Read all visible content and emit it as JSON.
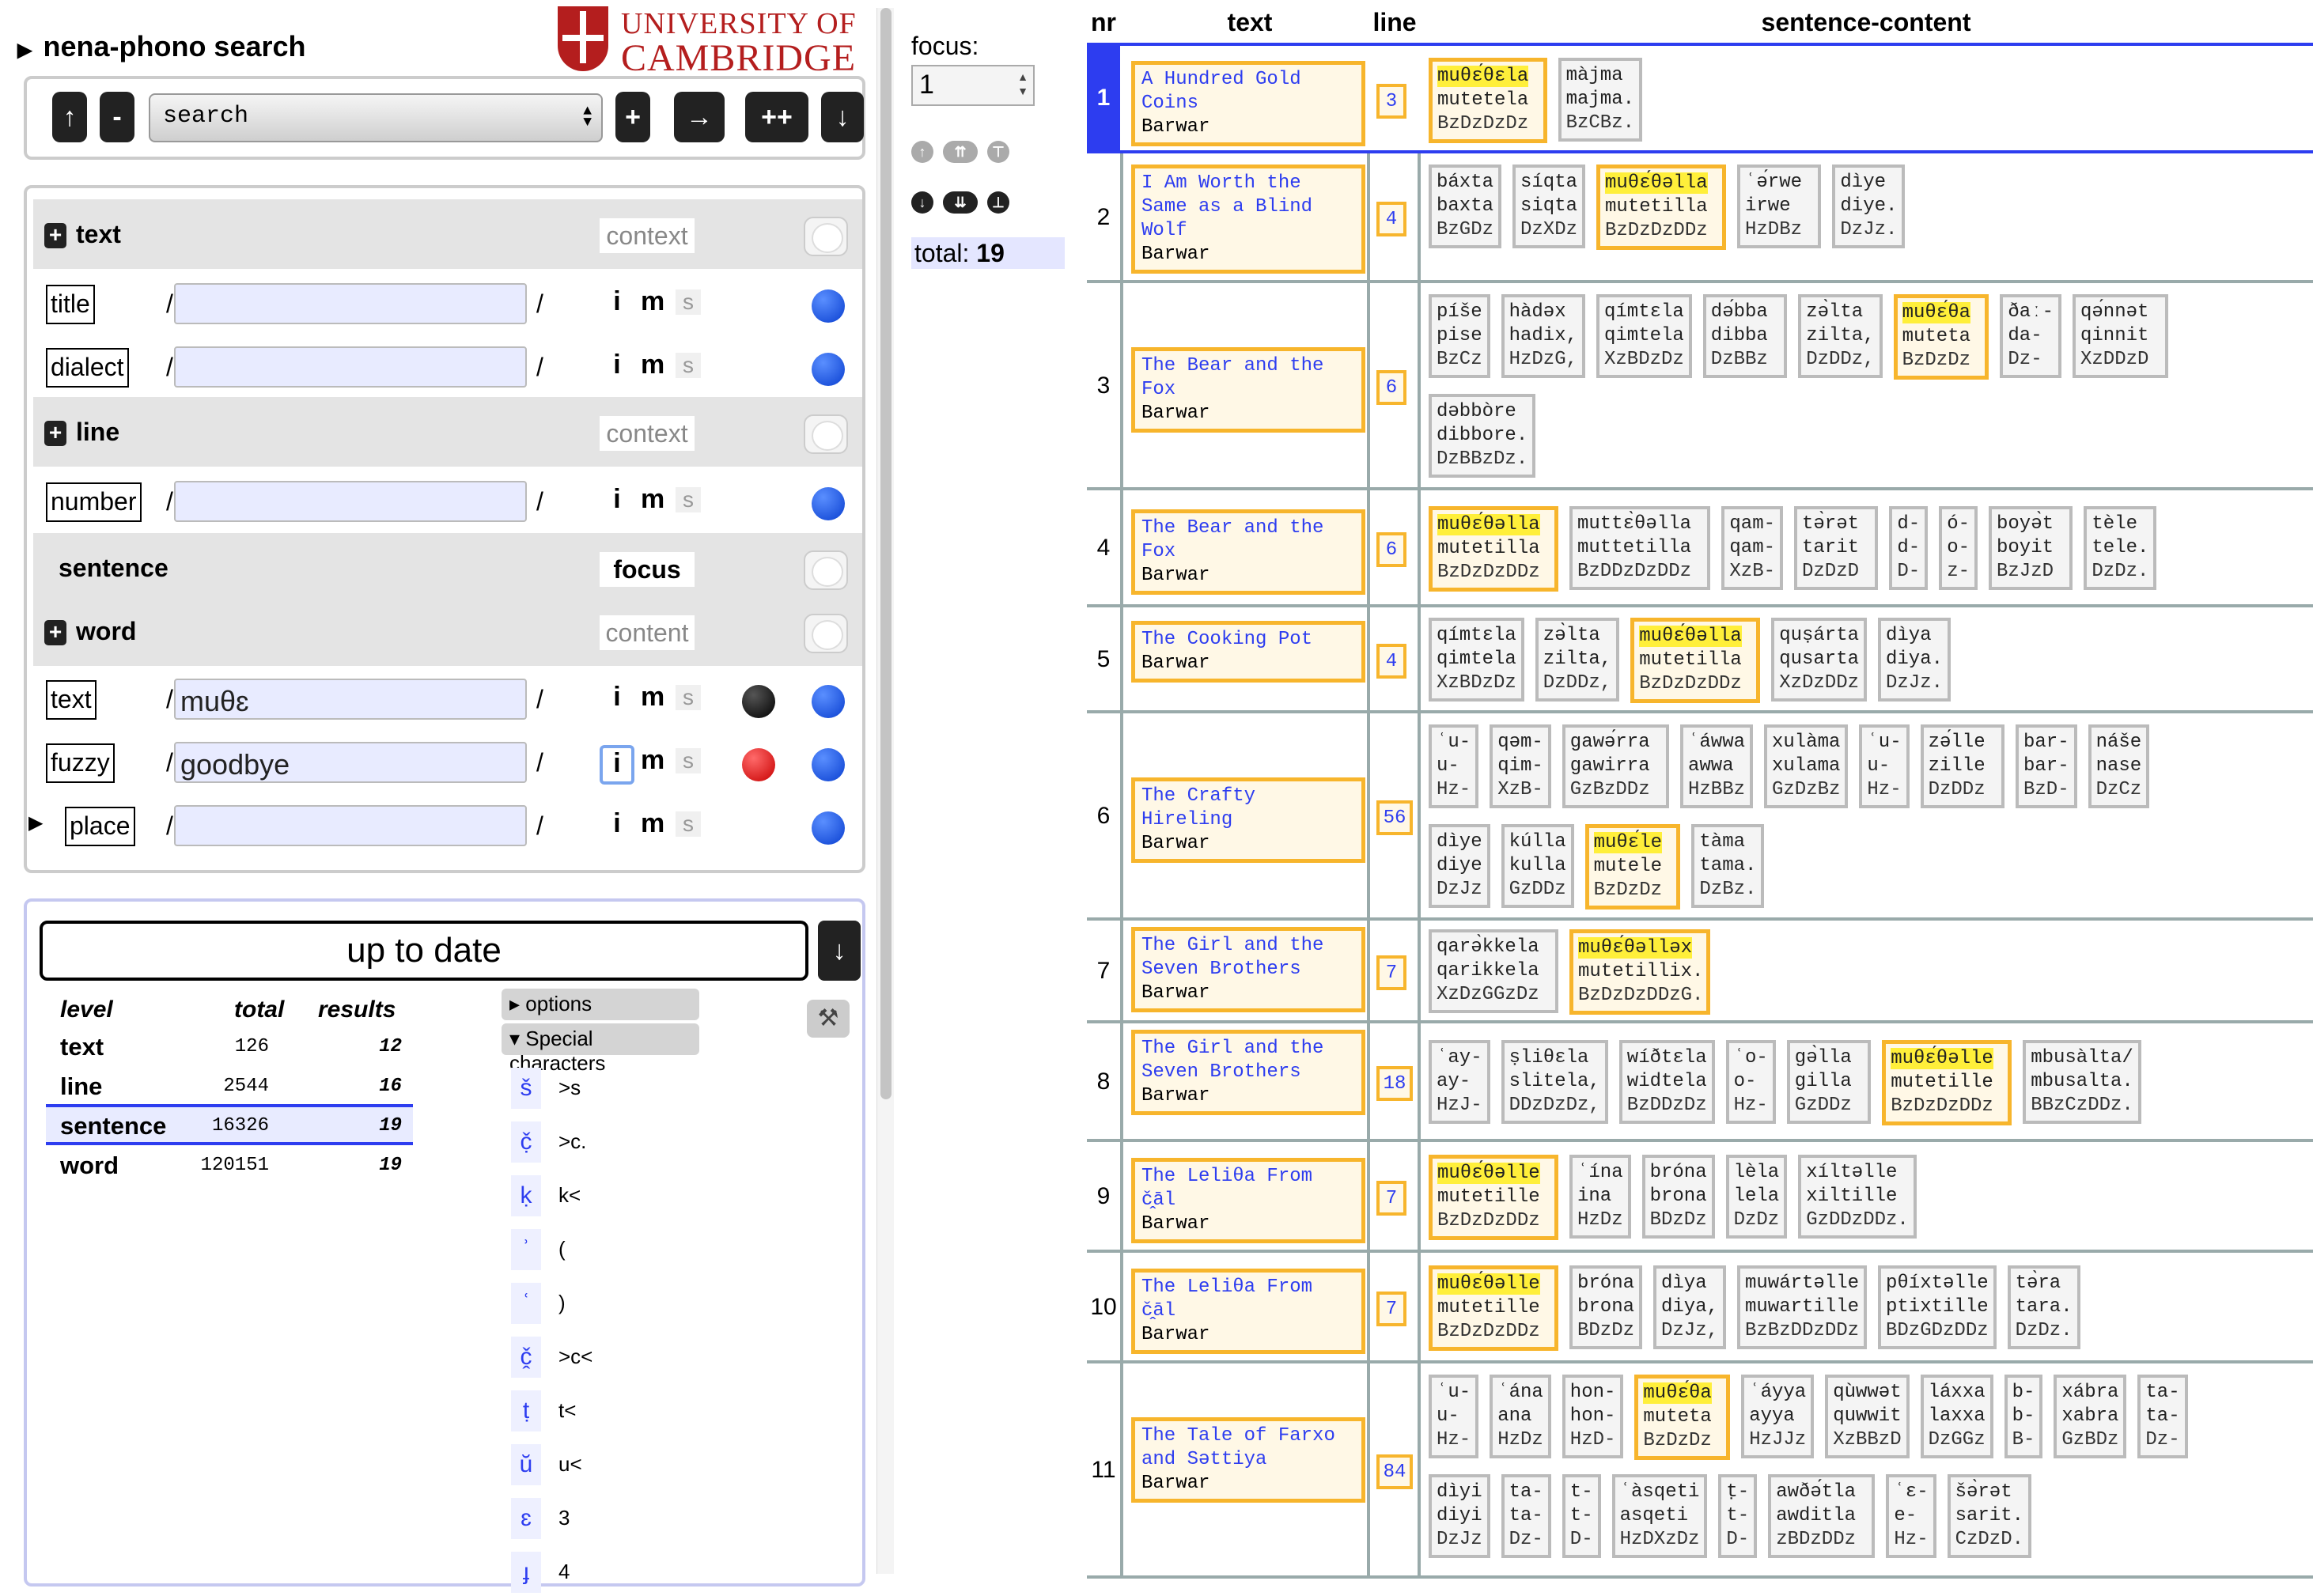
{
  "app": {
    "title": "nena-phono search"
  },
  "logo": {
    "line1": "UNIVERSITY OF",
    "line2": "CAMBRIDGE"
  },
  "toolbar": {
    "up": "↑",
    "minus": "-",
    "search_value": "search",
    "plus": "+",
    "next": "→",
    "plusplus": "++",
    "down": "↓"
  },
  "query": {
    "text_group": {
      "label": "text",
      "mode": "context"
    },
    "title_field": {
      "label": "title",
      "value": ""
    },
    "dialect_field": {
      "label": "dialect",
      "value": ""
    },
    "line_group": {
      "label": "line",
      "mode": "context"
    },
    "number_field": {
      "label": "number",
      "value": ""
    },
    "sentence_group": {
      "label": "sentence",
      "mode": "focus"
    },
    "word_group": {
      "label": "word",
      "mode": "content"
    },
    "wtext_field": {
      "label": "text",
      "value": "muθɛ"
    },
    "fuzzy_field": {
      "label": "fuzzy",
      "value": "goodbye"
    },
    "place_field": {
      "label": "place",
      "value": ""
    },
    "slash": "/",
    "i": "i",
    "m": "m",
    "s": "s",
    "plus_sign": "+"
  },
  "status": {
    "text": "up to date",
    "download": "↓"
  },
  "stats": {
    "headers": {
      "level": "level",
      "total": "total",
      "results": "results"
    },
    "rows": [
      {
        "level": "text",
        "total": "126",
        "results": "12"
      },
      {
        "level": "line",
        "total": "2544",
        "results": "16"
      },
      {
        "level": "sentence",
        "total": "16326",
        "results": "19"
      },
      {
        "level": "word",
        "total": "120151",
        "results": "19"
      }
    ]
  },
  "options": {
    "label": "options",
    "special": "Special characters",
    "tools_icon": "hammer-wrench-icon"
  },
  "special_chars": [
    {
      "glyph": "š",
      "key": ">s"
    },
    {
      "glyph": "č̣",
      "key": ">c."
    },
    {
      "glyph": "ḳ",
      "key": "k<"
    },
    {
      "glyph": "ʾ",
      "key": "("
    },
    {
      "glyph": "ʿ",
      "key": ")"
    },
    {
      "glyph": "č̭",
      "key": ">c<"
    },
    {
      "glyph": "ṭ",
      "key": "t<"
    },
    {
      "glyph": "ŭ",
      "key": "u<"
    },
    {
      "glyph": "ɛ",
      "key": "3"
    },
    {
      "glyph": "ɟ",
      "key": "4"
    }
  ],
  "focus": {
    "label": "focus:",
    "value": "1"
  },
  "total": {
    "label": "total:",
    "value": "19"
  },
  "results": {
    "headers": {
      "nr": "nr",
      "text": "text",
      "line": "line",
      "content": "sentence-content"
    },
    "rows": [
      {
        "nr": "1",
        "title": "A Hundred Gold Coins",
        "dialect": "Barwar",
        "line": "3",
        "words": [
          [
            "muθɛ́θɛla",
            "mutetela",
            "BzDzDzDz",
            1
          ],
          [
            "màjma",
            "majma.",
            "BzCBz.",
            0
          ]
        ]
      },
      {
        "nr": "2",
        "title": "I Am Worth the Same as a Blind Wolf",
        "dialect": "Barwar",
        "line": "4",
        "words": [
          [
            "báxta",
            "baxta",
            "BzGDz",
            0
          ],
          [
            "síqta",
            "siqta",
            "DzXDz",
            0
          ],
          [
            "muθɛ́θəlla",
            "mutetilla",
            "BzDzDzDDz",
            1
          ],
          [
            "ʿə́rwe",
            "irwe",
            "HzDBz",
            0
          ],
          [
            "dìye",
            "diye.",
            "DzJz.",
            0
          ]
        ]
      },
      {
        "nr": "3",
        "title": "The Bear and the Fox",
        "dialect": "Barwar",
        "line": "6",
        "words": [
          [
            "píše",
            "pise",
            "BzCz",
            0
          ],
          [
            "hàdəx",
            "hadix,",
            "HzDzG,",
            0
          ],
          [
            "qímtɛla",
            "qimtela",
            "XzBDzDz",
            0
          ],
          [
            "də́bba",
            "dibba",
            "DzBBz",
            0
          ],
          [
            "zə̀lta",
            "zilta,",
            "DzDDz,",
            0
          ],
          [
            "muθɛ́θa",
            "muteta",
            "BzDzDz",
            1
          ],
          [
            "ðaː-",
            "da-",
            "Dz-",
            0
          ],
          [
            "qə́nnət",
            "qinnit",
            "XzDDzD",
            0
          ],
          [
            "dəbbòre",
            "dibbore.",
            "DzBBzDz.",
            0
          ]
        ]
      },
      {
        "nr": "4",
        "title": "The Bear and the Fox",
        "dialect": "Barwar",
        "line": "6",
        "words": [
          [
            "muθɛ́θəlla",
            "mutetilla",
            "BzDzDzDDz",
            1
          ],
          [
            "muttɛ̀θəlla",
            "muttetilla",
            "BzDDzDzDDz",
            0
          ],
          [
            "qam-",
            "qam-",
            "XzB-",
            0
          ],
          [
            "tə̀rət",
            "tarit",
            "DzDzD",
            0
          ],
          [
            "d-",
            "d-",
            "D-",
            0
          ],
          [
            "ó-",
            "o-",
            "z-",
            0
          ],
          [
            "boyə̀t",
            "boyit",
            "BzJzD",
            0
          ],
          [
            "tèle",
            "tele.",
            "DzDz.",
            0
          ]
        ]
      },
      {
        "nr": "5",
        "title": "The Cooking Pot",
        "dialect": "Barwar",
        "line": "4",
        "words": [
          [
            "qímtɛla",
            "qimtela",
            "XzBDzDz",
            0
          ],
          [
            "zə̀lta",
            "zilta,",
            "DzDDz,",
            0
          ],
          [
            "muθɛ́θəlla",
            "mutetilla",
            "BzDzDzDDz",
            1
          ],
          [
            "quṣárta",
            "qusarta",
            "XzDzDDz",
            0
          ],
          [
            "dìya",
            "diya.",
            "DzJz.",
            0
          ]
        ]
      },
      {
        "nr": "6",
        "title": "The Crafty Hireling",
        "dialect": "Barwar",
        "line": "56",
        "words": [
          [
            "ʿu-",
            "u-",
            "Hz-",
            0
          ],
          [
            "qəm-",
            "qim-",
            "XzB-",
            0
          ],
          [
            "gawə́rra",
            "gawirra",
            "GzBzDDz",
            0
          ],
          [
            "ʿáwwa",
            "awwa",
            "HzBBz",
            0
          ],
          [
            "xulàma",
            "xulama",
            "GzDzBz",
            0
          ],
          [
            "ʿu-",
            "u-",
            "Hz-",
            0
          ],
          [
            "zə́lle",
            "zille",
            "DzDDz",
            0
          ],
          [
            "bar-",
            "bar-",
            "BzD-",
            0
          ],
          [
            "náše",
            "nase",
            "DzCz",
            0
          ],
          [
            "dìye",
            "diye",
            "DzJz",
            0
          ],
          [
            "kúlla",
            "kulla",
            "GzDDz",
            0
          ],
          [
            "muθɛ́le",
            "mutele",
            "BzDzDz",
            1
          ],
          [
            "tàma",
            "tama.",
            "DzBz.",
            0
          ]
        ]
      },
      {
        "nr": "7",
        "title": "The Girl and the Seven Brothers",
        "dialect": "Barwar",
        "line": "7",
        "words": [
          [
            "qarə̀kkela",
            "qarikkela",
            "XzDzGGzDz",
            0
          ],
          [
            "muθɛ́θəlləx",
            "mutetillix.",
            "BzDzDzDDzG.",
            1
          ]
        ]
      },
      {
        "nr": "8",
        "title": "The Girl and the Seven Brothers",
        "dialect": "Barwar",
        "line": "18",
        "words": [
          [
            "ʿay-",
            "ay-",
            "HzJ-",
            0
          ],
          [
            "ṣliθɛla",
            "slitela,",
            "DDzDzDz,",
            0
          ],
          [
            "wíðtɛla",
            "widtela",
            "BzDDzDz",
            0
          ],
          [
            "ʿo-",
            "o-",
            "Hz-",
            0
          ],
          [
            "gə̀lla",
            "gilla",
            "GzDDz",
            0
          ],
          [
            "muθɛ́θəlle",
            "mutetille",
            "BzDzDzDDz",
            1
          ],
          [
            "mbusàlta/",
            "mbusalta.",
            "BBzCzDDz.",
            0
          ]
        ]
      },
      {
        "nr": "9",
        "title": "The Leliθa From č̭āl",
        "dialect": "Barwar",
        "line": "7",
        "words": [
          [
            "muθɛ́θəlle",
            "mutetille",
            "BzDzDzDDz",
            1
          ],
          [
            "ʿína",
            "ina",
            "HzDz",
            0
          ],
          [
            "bróna",
            "brona",
            "BDzDz",
            0
          ],
          [
            "lèla",
            "lela",
            "DzDz",
            0
          ],
          [
            "xíltəlle",
            "xiltille",
            "GzDDzDDz.",
            0
          ]
        ]
      },
      {
        "nr": "10",
        "title": "The Leliθa From č̭āl",
        "dialect": "Barwar",
        "line": "7",
        "words": [
          [
            "muθɛ́θəlle",
            "mutetille",
            "BzDzDzDDz",
            1
          ],
          [
            "bróna",
            "brona",
            "BDzDz",
            0
          ],
          [
            "dìya",
            "diya,",
            "DzJz,",
            0
          ],
          [
            "muwártəlle",
            "muwartille",
            "BzBzDDzDDz",
            0
          ],
          [
            "pθíxtəlle",
            "ptixtille",
            "BDzGDzDDz",
            0
          ],
          [
            "tə̀ra",
            "tara.",
            "DzDz.",
            0
          ]
        ]
      },
      {
        "nr": "11",
        "title": "The Tale of Farxo and Səttiya",
        "dialect": "Barwar",
        "line": "84",
        "words": [
          [
            "ʿu-",
            "u-",
            "Hz-",
            0
          ],
          [
            "ʿána",
            "ana",
            "HzDz",
            0
          ],
          [
            "hon-",
            "hon-",
            "HzD-",
            0
          ],
          [
            "muθɛ́θa",
            "muteta",
            "BzDzDz",
            1
          ],
          [
            "ʿáyya",
            "ayya",
            "HzJJz",
            0
          ],
          [
            "qùwwət",
            "quwwit",
            "XzBBzD",
            0
          ],
          [
            "láxxa",
            "laxxa",
            "DzGGz",
            0
          ],
          [
            "b-",
            "b-",
            "B-",
            0
          ],
          [
            "xábra",
            "xabra",
            "GzBDz",
            0
          ],
          [
            "ta-",
            "ta-",
            "Dz-",
            0
          ],
          [
            "dìyi",
            "diyi",
            "DzJz",
            0
          ],
          [
            "ta-",
            "ta-",
            "Dz-",
            0
          ],
          [
            "t-",
            "t-",
            "D-",
            0
          ],
          [
            "ʿàsqeti",
            "asqeti",
            "HzDXzDz",
            0
          ],
          [
            "ṭ-",
            "t-",
            "D-",
            0
          ],
          [
            "awðə́tla",
            "awditla",
            "zBDzDDz",
            0
          ],
          [
            "ʿɛ-",
            "e-",
            "Hz-",
            0
          ],
          [
            "šə̀rət",
            "sarit.",
            "CzDzD.",
            0
          ]
        ]
      }
    ]
  }
}
